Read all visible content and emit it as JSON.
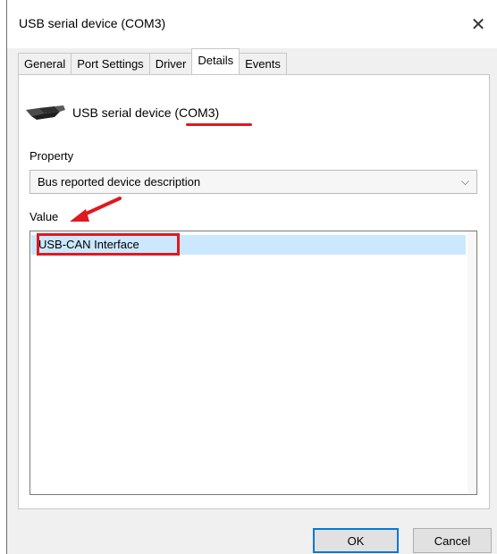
{
  "window": {
    "title": "USB serial device (COM3)",
    "close_symbol": "✕"
  },
  "tabs": [
    {
      "label": "General",
      "active": false
    },
    {
      "label": "Port Settings",
      "active": false
    },
    {
      "label": "Driver",
      "active": false
    },
    {
      "label": "Details",
      "active": true
    },
    {
      "label": "Events",
      "active": false
    }
  ],
  "device": {
    "icon": "usb-plug-icon",
    "name_prefix": "USB serial device ",
    "name_port": "(COM3)"
  },
  "property": {
    "label": "Property",
    "selected": "Bus reported device description",
    "chevron": "chevron-down-icon"
  },
  "value": {
    "label": "Value",
    "items": [
      "USB-CAN Interface"
    ]
  },
  "buttons": {
    "ok": "OK",
    "cancel": "Cancel"
  },
  "annotations": {
    "color": "#e0191e",
    "selection_color": "#cce8ff"
  }
}
